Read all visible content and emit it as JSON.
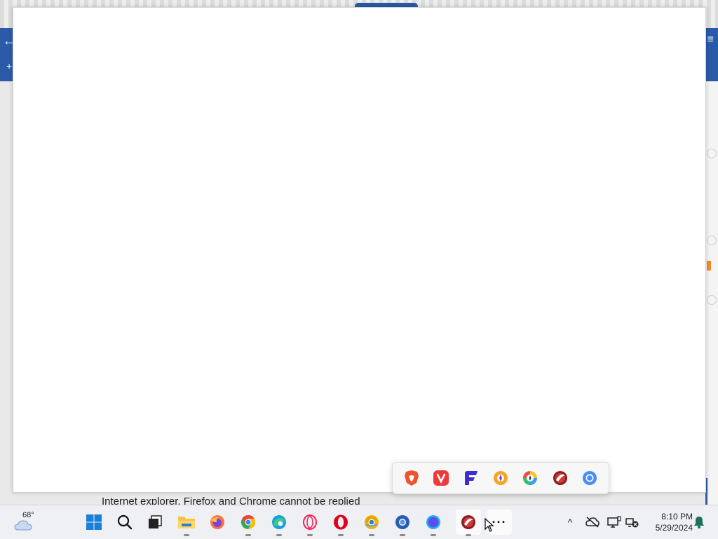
{
  "background_page": {
    "visible_text": "Internet explorer, Firefox and Chrome cannot be replied",
    "header_back_glyph": "←",
    "header_menu_glyph": "≡",
    "header_plus_glyph": "+"
  },
  "flyout": {
    "items": [
      {
        "icon": "brave-icon",
        "color": "#f0522b"
      },
      {
        "icon": "vivaldi-icon",
        "color": "#ef3939"
      },
      {
        "icon": "floorp-icon",
        "color": "#3b2fd1"
      },
      {
        "icon": "browser-orange-icon",
        "color": "#f5a623"
      },
      {
        "icon": "browser-colorful-icon",
        "color": "#3aa1e0"
      },
      {
        "icon": "browser-red-icon",
        "color": "#c82a2a"
      },
      {
        "icon": "chromium-icon",
        "color": "#4a8cf7"
      }
    ]
  },
  "taskbar": {
    "weather": {
      "temperature": "68°",
      "icon": "cloud-icon"
    },
    "pinned": [
      {
        "name": "start",
        "icon": "windows-start-icon"
      },
      {
        "name": "search",
        "icon": "search-icon"
      },
      {
        "name": "task-view",
        "icon": "task-view-icon"
      },
      {
        "name": "file-explorer",
        "icon": "folder-icon"
      },
      {
        "name": "firefox",
        "icon": "firefox-icon"
      },
      {
        "name": "chrome",
        "icon": "chrome-icon"
      },
      {
        "name": "edge",
        "icon": "edge-icon"
      },
      {
        "name": "opera-gx",
        "icon": "opera-outline-icon"
      },
      {
        "name": "opera",
        "icon": "opera-icon"
      },
      {
        "name": "chrome-canary",
        "icon": "chrome-canary-icon"
      },
      {
        "name": "chromium-blue",
        "icon": "chromium-blue-icon"
      },
      {
        "name": "browser-blue-circle",
        "icon": "blue-circle-icon"
      },
      {
        "name": "browser-red",
        "icon": "browser-red-icon"
      },
      {
        "name": "more",
        "icon": "more-icon",
        "glyph": "···"
      }
    ],
    "tray": {
      "chevron_glyph": "^",
      "icons": [
        "onedrive-offline-icon",
        "display-icon",
        "network-off-icon"
      ]
    },
    "clock": {
      "time": "8:10 PM",
      "date": "5/29/2024"
    },
    "notification_icon": "bell-icon"
  }
}
